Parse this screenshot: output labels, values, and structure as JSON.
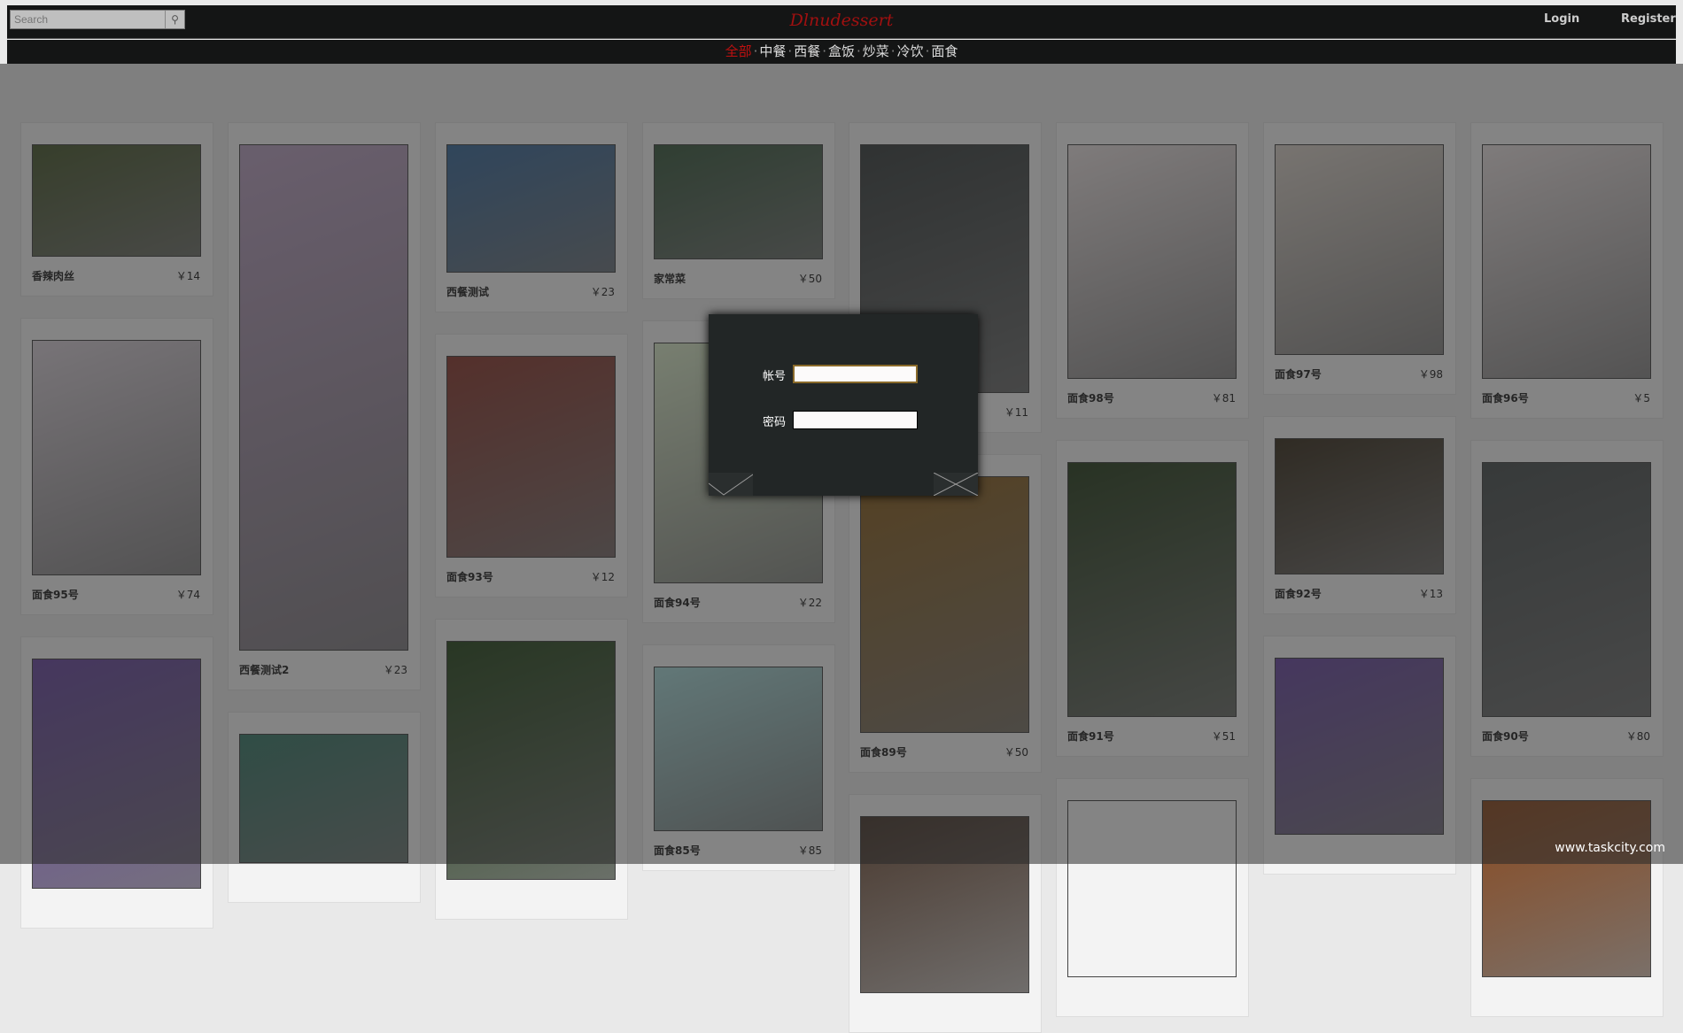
{
  "header": {
    "search_placeholder": "Search",
    "search_icon": "magnifier-icon",
    "logo": "Dlnudessert",
    "login": "Login",
    "register": "Register"
  },
  "nav": {
    "items": [
      "全部",
      "中餐",
      "西餐",
      "盒饭",
      "炒菜",
      "冷饮",
      "面食"
    ],
    "active": "全部",
    "active_color": "#c01010"
  },
  "columns": [
    [
      {
        "name": "香辣肉丝",
        "price": "￥14"
      },
      {
        "name": "面食95号",
        "price": "￥74"
      },
      {
        "name": "",
        "price": ""
      }
    ],
    [
      {
        "name": "西餐测试2",
        "price": "￥23"
      },
      {
        "name": "",
        "price": ""
      }
    ],
    [
      {
        "name": "西餐测试",
        "price": "￥23"
      },
      {
        "name": "面食93号",
        "price": "￥12"
      },
      {
        "name": "",
        "price": ""
      }
    ],
    [
      {
        "name": "家常菜",
        "price": "￥50"
      },
      {
        "name": "面食94号",
        "price": "￥22"
      },
      {
        "name": "面食85号",
        "price": "￥85"
      }
    ],
    [
      {
        "name": "",
        "price": "￥11"
      },
      {
        "name": "面食89号",
        "price": "￥50"
      },
      {
        "name": "",
        "price": ""
      }
    ],
    [
      {
        "name": "面食98号",
        "price": "￥81"
      },
      {
        "name": "面食91号",
        "price": "￥51"
      },
      {
        "name": "",
        "price": ""
      }
    ],
    [
      {
        "name": "面食97号",
        "price": "￥98"
      },
      {
        "name": "面食92号",
        "price": "￥13"
      },
      {
        "name": "",
        "price": ""
      }
    ],
    [
      {
        "name": "面食96号",
        "price": "￥5"
      },
      {
        "name": "面食90号",
        "price": "￥80"
      },
      {
        "name": "",
        "price": ""
      }
    ]
  ],
  "login_modal": {
    "account_label": "帐号",
    "password_label": "密码",
    "account_value": "",
    "password_value": "",
    "confirm_icon": "check-icon",
    "cancel_icon": "close-icon"
  },
  "footer": "www.taskcity.com"
}
